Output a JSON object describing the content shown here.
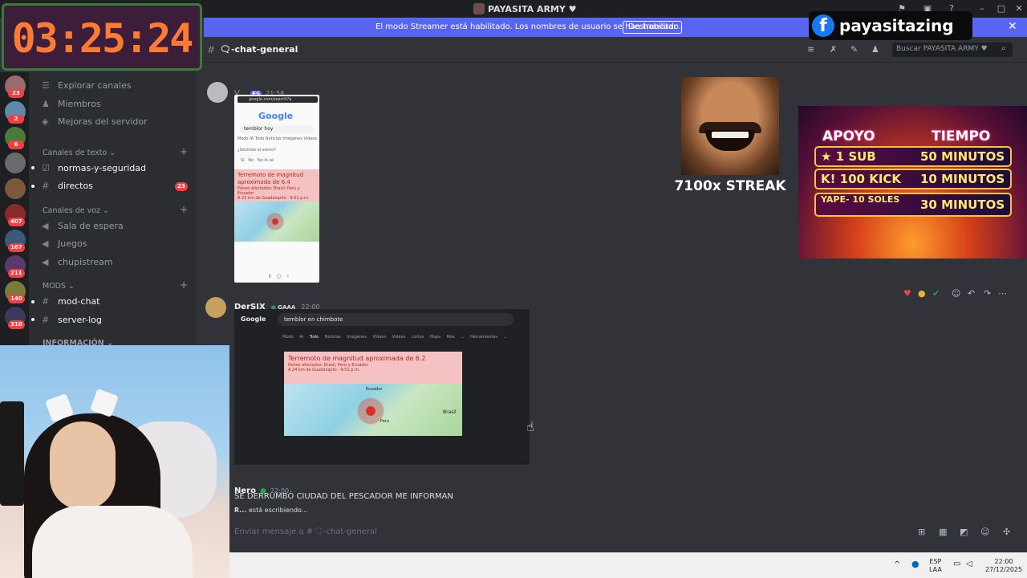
{
  "window": {
    "title": "PAYASITA ARMY ♥"
  },
  "streamer_banner": {
    "text": "El modo Streamer está habilitado. Los nombres de usuario se han truncado.",
    "button": "Deshabilitar"
  },
  "overlay": {
    "timer": "03:25:24",
    "facebook_name": "payasitazing",
    "streak": "7100x STREAK"
  },
  "promo": {
    "head_left": "APOYO",
    "head_right": "TIEMPO",
    "rows": [
      {
        "left": "★ 1 SUB",
        "right": "50 MINUTOS"
      },
      {
        "left": "K! 100 KICK",
        "right": "10 MINUTOS"
      },
      {
        "left": "YAPE- 10 SOLES",
        "right": "30 MINUTOS"
      }
    ]
  },
  "server_badges": [
    "23",
    "2",
    "6",
    "407",
    "167",
    "211",
    "140",
    "310"
  ],
  "sidebar": {
    "top_items": [
      {
        "label": "Explorar canales",
        "icon": "compass-icon"
      },
      {
        "label": "Miembros",
        "icon": "members-icon"
      },
      {
        "label": "Mejoras del servidor",
        "icon": "boost-icon"
      }
    ],
    "categories": [
      {
        "label": "Canales de texto ⌄"
      },
      {
        "label": "Canales de voz ⌄"
      },
      {
        "label": "MODS ⌄"
      },
      {
        "label": "INFORMACIÓN ⌄"
      }
    ],
    "text_channels": [
      {
        "label": "normas-y-seguridad"
      },
      {
        "label": "directos",
        "badge": "23"
      }
    ],
    "voice_channels": [
      {
        "label": "Sala de espera"
      },
      {
        "label": "Juegos"
      },
      {
        "label": "chupistream"
      }
    ],
    "mod_channels": [
      {
        "label": "mod-chat"
      },
      {
        "label": "server-log"
      }
    ]
  },
  "channel_header": {
    "name": "🗨-chat-general",
    "search_placeholder": "Buscar PAYASITA ARMY ♥"
  },
  "messages": [
    {
      "author": "V...",
      "tag": "FS",
      "time": "21:58",
      "screenshot": {
        "url": "google.com/search?q",
        "query": "temblor hoy",
        "tabs": [
          "Modo IA",
          "Todo",
          "Noticias",
          "Imágenes",
          "Videos"
        ],
        "felt_question": "¿Sentiste el sismo?",
        "felt_options": [
          "Sí",
          "No",
          "No lo sé"
        ],
        "quake_title": "Terremoto de magnitud aproximada de 6.4",
        "quake_sub": "Países afectados: Brasil, Perú y Ecuador",
        "quake_loc": "A 22 km de Guadalupito · 9:51 p.m."
      }
    },
    {
      "author": "DerSIX",
      "tag": "GAAA",
      "time": "22:00",
      "screenshot": {
        "query": "temblor en chimbote",
        "tabs": [
          "Modo IA",
          "Todo",
          "Noticias",
          "Imágenes",
          "Videos",
          "Videos cortos",
          "Maps",
          "Más ⌄",
          "Herramientas ⌄"
        ],
        "quake_title": "Terremoto de magnitud aproximada de 6.2",
        "quake_sub": "Países afectados: Brasil, Perú y Ecuador",
        "quake_loc": "A 24 km de Guadalupito · 9:51 p.m.",
        "map_labels": [
          "Ecuador",
          "Brasil",
          "Perú"
        ]
      }
    },
    {
      "author": "Nero",
      "time": "22:00",
      "text": "SE DERRUMBÓ CIUDAD DEL PESCADOR ME INFORMAN"
    }
  ],
  "typing": {
    "user": "R...",
    "text": "está escribiendo..."
  },
  "composer": {
    "placeholder": "Enviar mensaje a #🗨-chat-general"
  },
  "taskbar": {
    "lang_top": "ESP",
    "lang_bottom": "LAA",
    "time": "22:00",
    "date": "27/12/2025"
  }
}
